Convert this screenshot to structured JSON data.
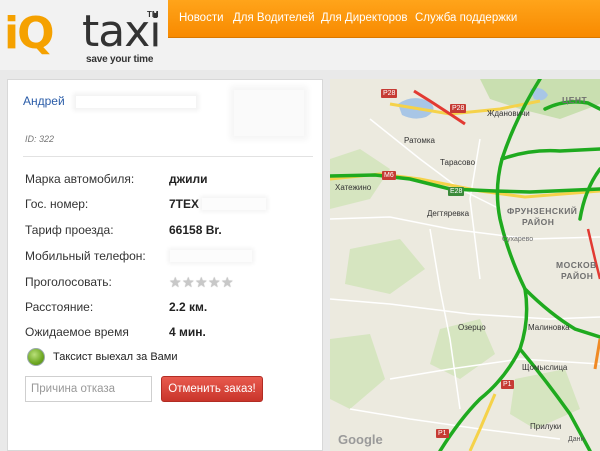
{
  "logo": {
    "iq": "iQ",
    "taxi": "taxi",
    "tm": "TM",
    "slogan": "save your time"
  },
  "nav": [
    "Новости",
    "Для Водителей",
    "Для Директоров",
    "Служба поддержки"
  ],
  "user": {
    "name": "Андрей",
    "id": "ID: 322"
  },
  "details": [
    {
      "label": "Марка автомобиля:",
      "value": "джили"
    },
    {
      "label": "Гос. номер:",
      "value": "7ТЕХ"
    },
    {
      "label": "Тариф проезда:",
      "value": "66158 Br."
    },
    {
      "label": "Мобильный телефон:",
      "value": ""
    },
    {
      "label": "Проголосовать:",
      "value": ""
    },
    {
      "label": "Расстояние:",
      "value": "2.2 км."
    },
    {
      "label": "Ожидаемое время",
      "value": "4 мин."
    }
  ],
  "rating": {
    "stars_total": 5,
    "stars_filled": 0
  },
  "status": "Таксист выехал за Вами",
  "reason": {
    "placeholder": "Причина отказа",
    "value": ""
  },
  "cancel_button": "Отменить заказ!",
  "map": {
    "places": [
      "Ждановичи",
      "Ратомка",
      "Тарасово",
      "Хатежино",
      "Дегтяревка",
      "Сухарево",
      "Озерцо",
      "Малиновка",
      "Щомыслица",
      "Прилуки",
      "ЦЕНТ"
    ],
    "districts": [
      "ФРУНЗЕНСКИЙ",
      "РАЙОН",
      "МОСКОВ",
      "РАЙОН"
    ],
    "roads": [
      "P28",
      "P28",
      "M6",
      "E28",
      "P1",
      "P1"
    ],
    "google": "Google",
    "credit": "Данн"
  },
  "colors": {
    "nav_orange": "#f88a00",
    "logo_orange": "#f5a100",
    "link_blue": "#2a5ca8",
    "cancel_red": "#c9352b",
    "traffic_green": "#1faa1f"
  }
}
